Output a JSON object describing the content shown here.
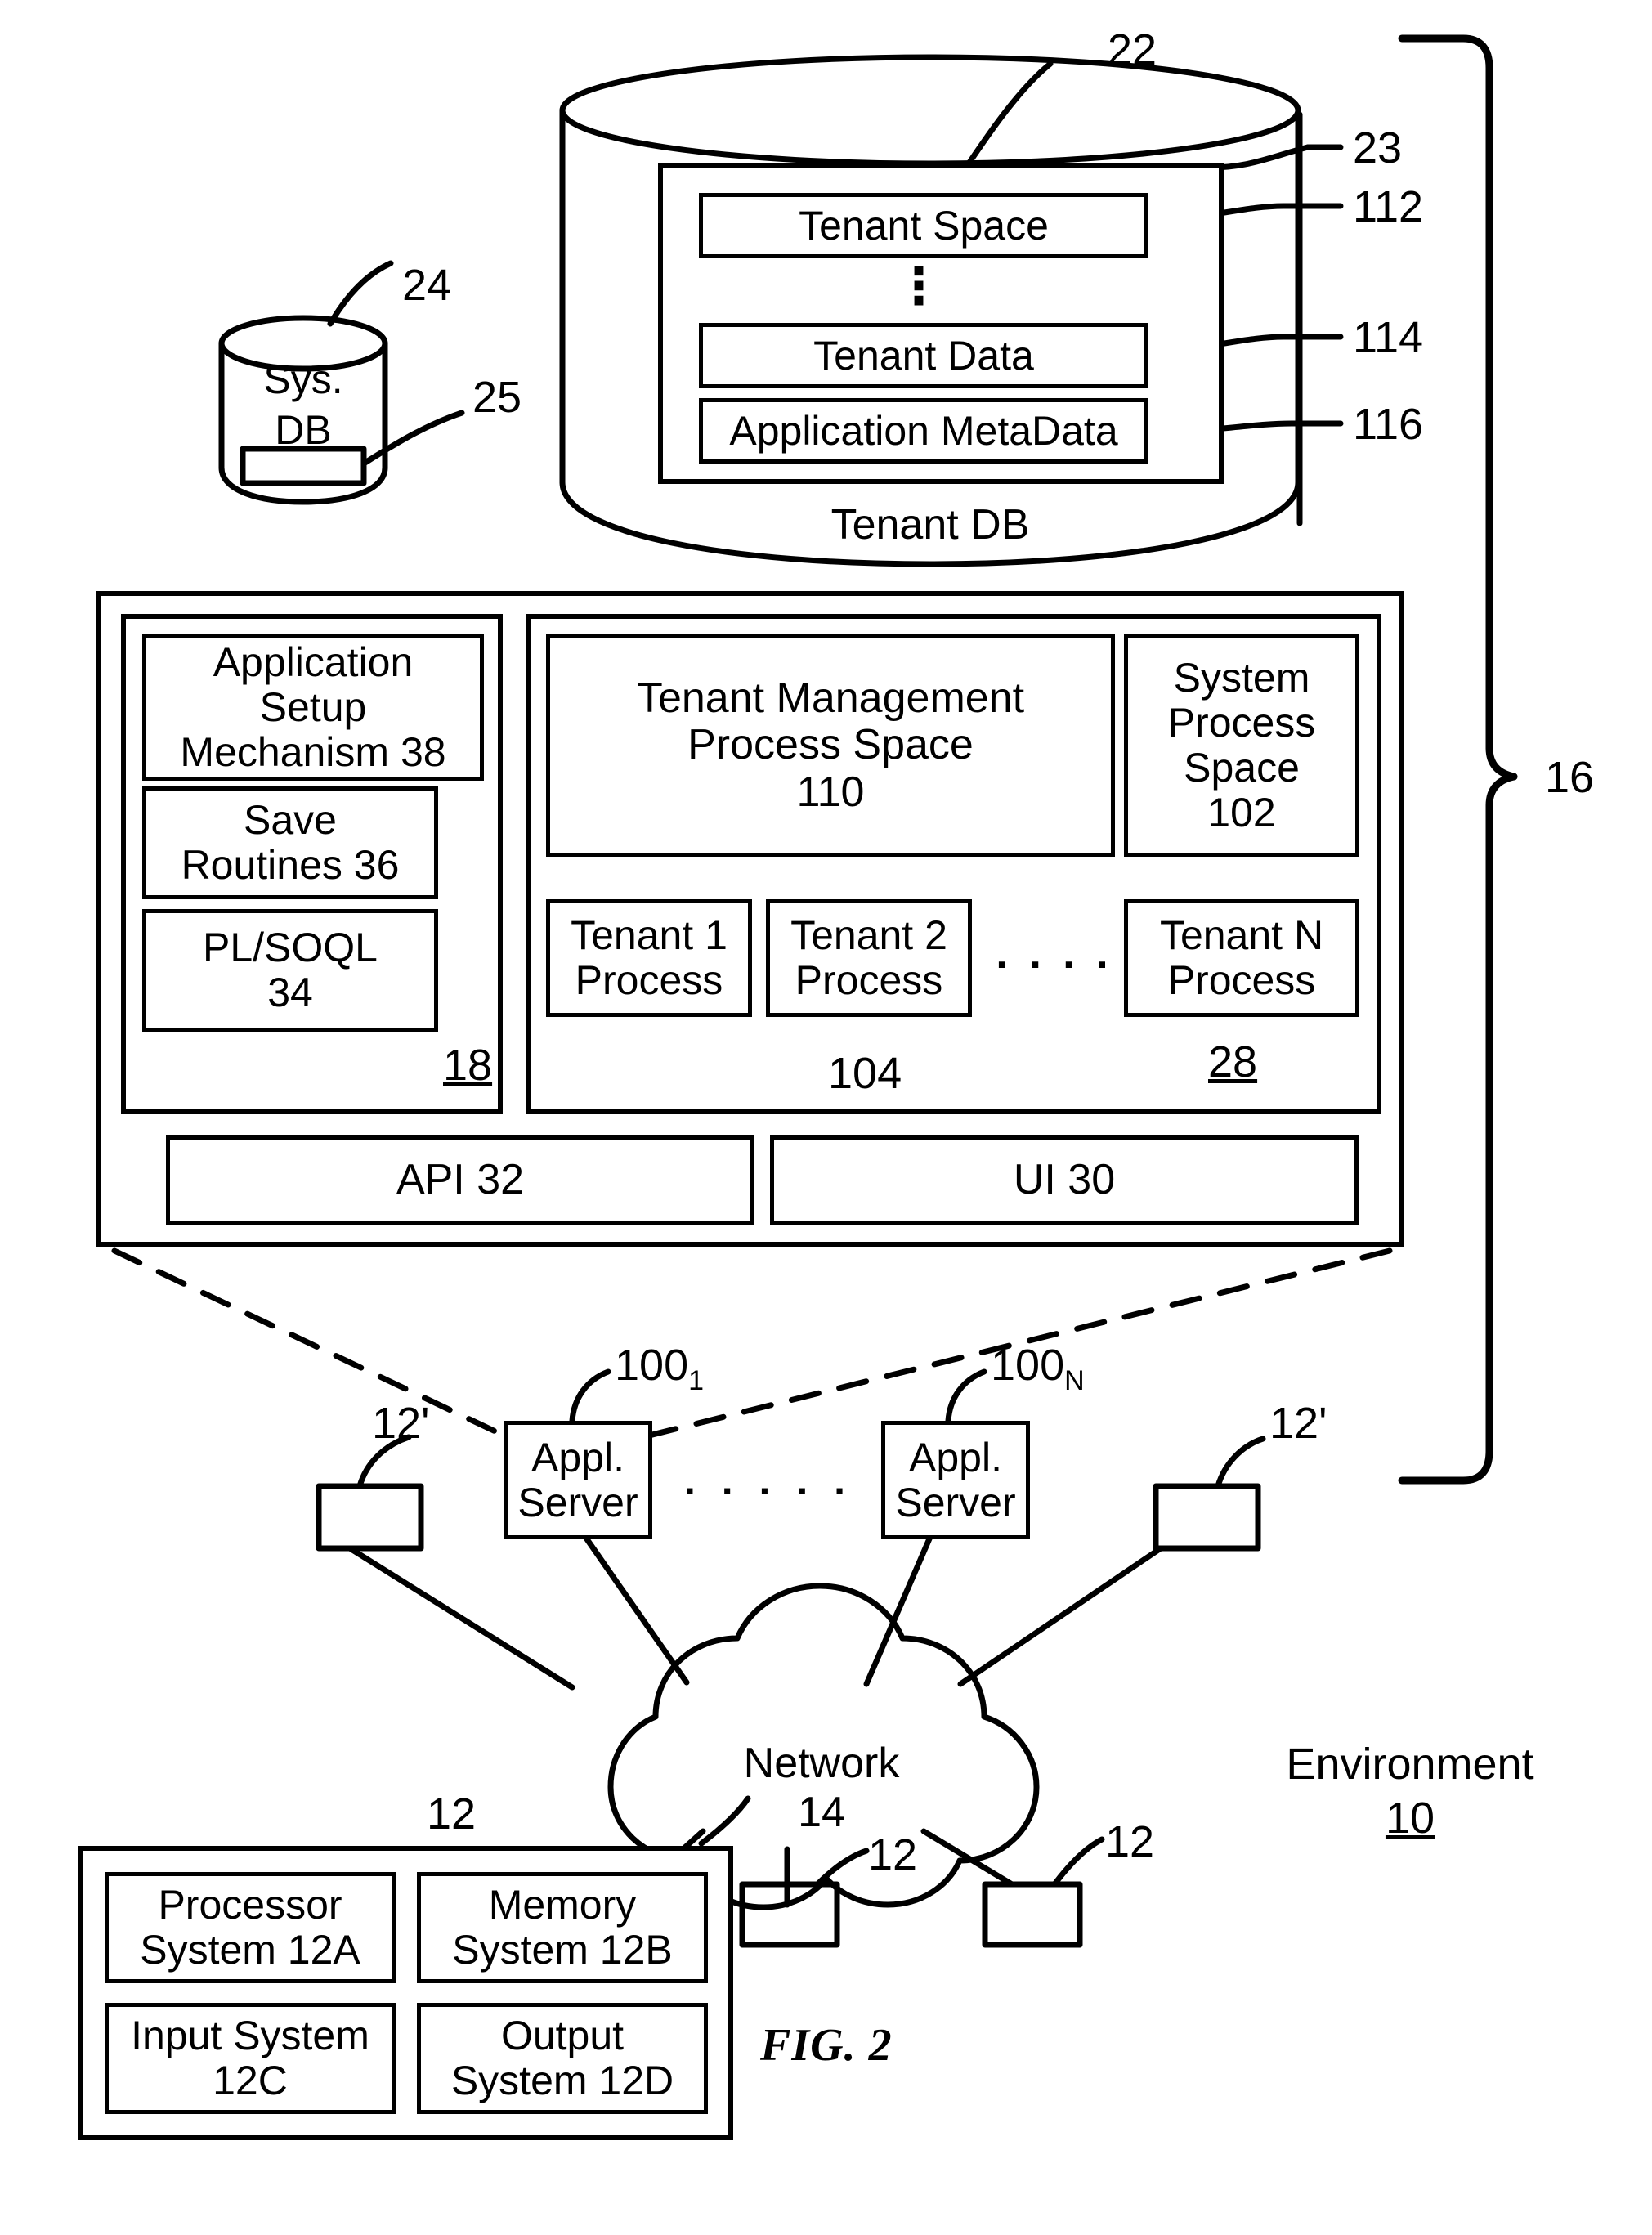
{
  "figure": {
    "caption": "FIG. 2",
    "environment_label": "Environment",
    "environment_ref": "10",
    "system_bracket_ref": "16"
  },
  "tenant_db": {
    "title": "Tenant DB",
    "ref_cylinder": "22",
    "ref_inner_container": "23",
    "rows": [
      {
        "label": "Tenant Space",
        "ref": "112"
      },
      {
        "label": "Tenant Data",
        "ref": "114"
      },
      {
        "label": "Application MetaData",
        "ref": "116"
      }
    ],
    "vertical_ellipsis": "⋮"
  },
  "sys_db": {
    "line1": "Sys.",
    "line2": "DB",
    "ref_cylinder": "24",
    "ref_inner": "25"
  },
  "program_code": {
    "ref": "18",
    "blocks": [
      {
        "label": "Application\nSetup\nMechanism 38",
        "name": "application-setup-mechanism"
      },
      {
        "label": "Save\nRoutines 36",
        "name": "save-routines"
      },
      {
        "label": "PL/SOQL\n34",
        "name": "pl-soql"
      }
    ]
  },
  "process_space": {
    "ref": "28",
    "tenant_management": {
      "line1": "Tenant Management",
      "line2": "Process Space",
      "line3": "110"
    },
    "system_process": {
      "line1": "System",
      "line2": "Process",
      "line3": "Space",
      "line4": "102"
    },
    "tenant_processes": [
      {
        "line1": "Tenant 1",
        "line2": "Process"
      },
      {
        "line1": "Tenant 2",
        "line2": "Process"
      },
      {
        "line1": "Tenant N",
        "line2": "Process"
      }
    ],
    "tenant_process_ref": "104",
    "ellipsis_dots": ". . . ."
  },
  "interfaces": [
    {
      "label": "API 32",
      "name": "api-bar"
    },
    {
      "label": "UI 30",
      "name": "ui-bar"
    }
  ],
  "app_servers": [
    {
      "line1": "Appl.",
      "line2": "Server",
      "ref": "100",
      "ref_sub": "1"
    },
    {
      "line1": "Appl.",
      "line2": "Server",
      "ref": "100",
      "ref_sub": "N"
    }
  ],
  "app_server_ellipsis": ". . . . .",
  "network": {
    "line1": "Network",
    "line2": "14"
  },
  "user_system": {
    "ref": "12",
    "cells": [
      {
        "line1": "Processor",
        "line2": "System 12A",
        "name": "processor-system"
      },
      {
        "line1": "Memory",
        "line2": "System 12B",
        "name": "memory-system"
      },
      {
        "line1": "Input System",
        "line2": "12C",
        "name": "input-system"
      },
      {
        "line1": "Output",
        "line2": "System 12D",
        "name": "output-system"
      }
    ]
  },
  "user_system_refs": [
    {
      "text": "12'",
      "name": "user-system-left-ref"
    },
    {
      "text": "12'",
      "name": "user-system-right-ref"
    },
    {
      "text": "12",
      "name": "user-system-center-ref"
    },
    {
      "text": "12",
      "name": "user-system-lower-right-ref"
    }
  ],
  "colors": {
    "ink": "#000000",
    "paper": "#ffffff"
  }
}
